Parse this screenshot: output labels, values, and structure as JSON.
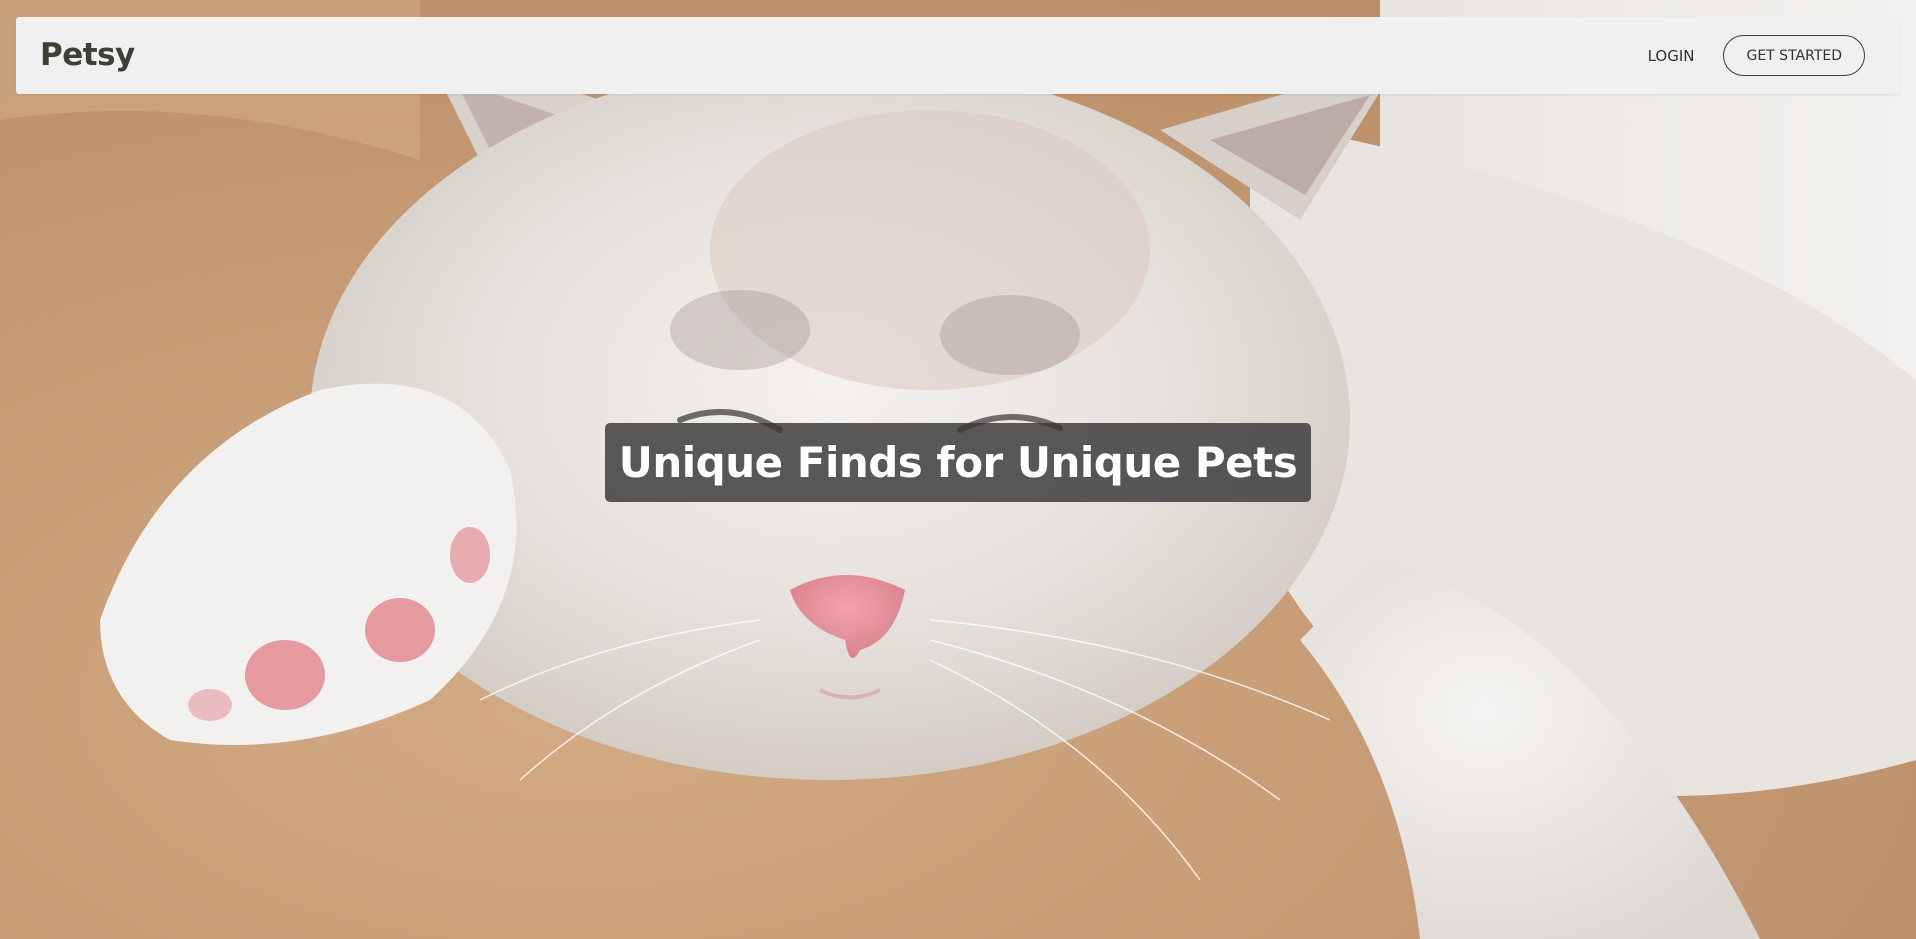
{
  "navbar": {
    "brand": "Petsy",
    "login_label": "LOGIN",
    "get_started_label": "GET STARTED"
  },
  "hero": {
    "title": "Unique Finds for Unique Pets",
    "image_subject": "sleeping white kitten on tan blanket"
  },
  "colors": {
    "navbar_background": "#f0f0f0",
    "brand_text": "#3d4035",
    "title_box_background": "#373737",
    "title_text": "#ffffff"
  }
}
